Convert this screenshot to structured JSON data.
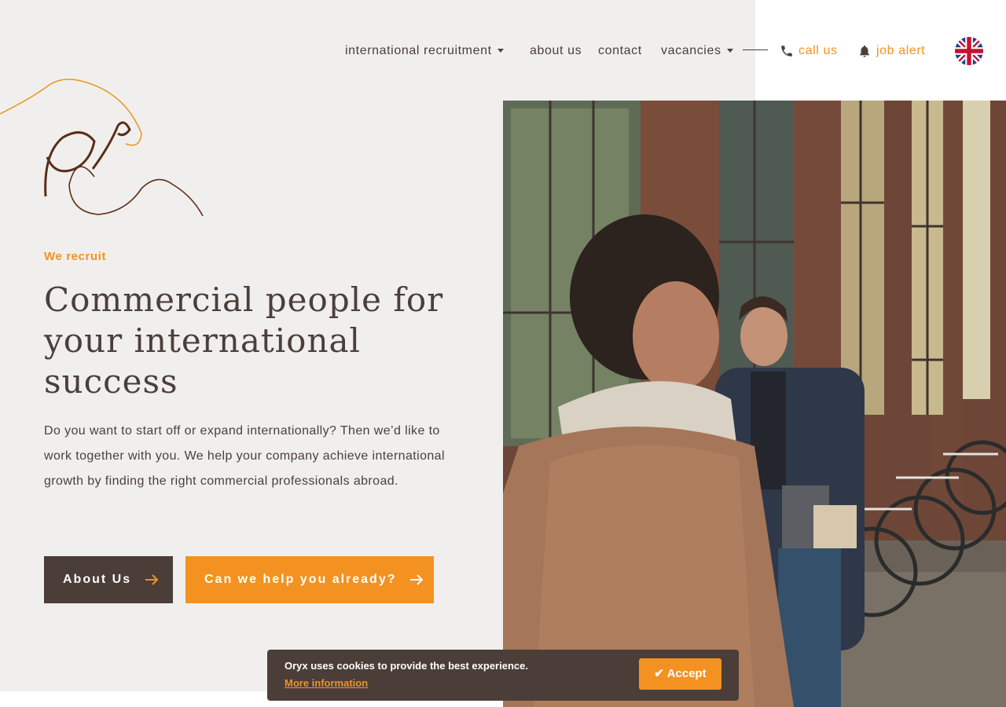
{
  "nav": {
    "items": [
      {
        "label": "international recruitment",
        "has_dropdown": true
      },
      {
        "label": "about us",
        "has_dropdown": false
      },
      {
        "label": "contact",
        "has_dropdown": false
      },
      {
        "label": "vacancies",
        "has_dropdown": true
      }
    ],
    "call_label": "call us",
    "call_icon": "phone-icon",
    "alert_label": "job alert",
    "alert_icon": "bell-icon",
    "language_icon": "uk-flag-icon"
  },
  "hero": {
    "eyebrow": "We recruit",
    "headline": "Commercial people for your international success",
    "lead": "Do you want to start off or expand internationally? Then we’d like to work together with you. We help your company achieve international growth by finding the right commercial professionals abroad.",
    "primary_button": "About Us",
    "secondary_button": "Can we help you already?"
  },
  "cookie": {
    "message": "Oryx uses cookies to provide the best experience.",
    "more_info": "More information",
    "accept": "✔ Accept"
  },
  "colors": {
    "accent": "#f39220",
    "dark": "#4b3d38",
    "background": "#f1efed"
  }
}
